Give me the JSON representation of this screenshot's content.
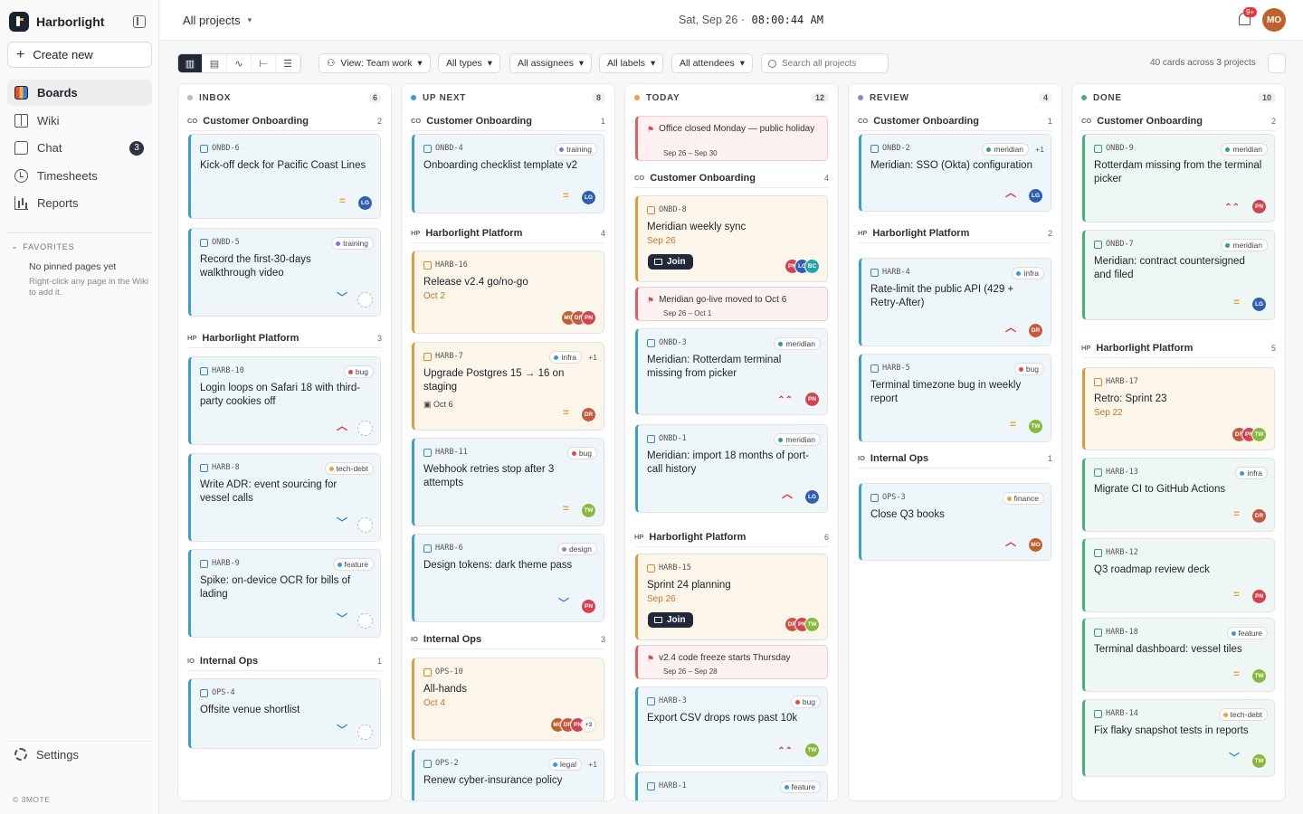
{
  "app": {
    "name": "Harborlight",
    "create_label": "Create new",
    "copyright": "© 3MOTE"
  },
  "nav": [
    {
      "label": "Boards",
      "icon": "boards-icon"
    },
    {
      "label": "Wiki",
      "icon": "book-icon"
    },
    {
      "label": "Chat",
      "icon": "chat-icon",
      "badge": "3"
    },
    {
      "label": "Timesheets",
      "icon": "clock-icon"
    },
    {
      "label": "Reports",
      "icon": "bar-chart-icon"
    }
  ],
  "favorites": {
    "heading": "FAVORITES",
    "empty": "No pinned pages yet",
    "hint": "Right-click any page in the Wiki to add it."
  },
  "settings_label": "Settings",
  "header": {
    "project": "All projects",
    "date": "Sat, Sep 26",
    "sep": "·",
    "time": "08:00:44 AM",
    "notif_badge": "9+",
    "user_initials": "MO"
  },
  "toolbar": {
    "view": "View: Team work",
    "types": "All types",
    "assignees": "All assignees",
    "labels": "All labels",
    "attendees": "All attendees",
    "search_placeholder": "Search all projects",
    "count": "40 cards across 3 projects"
  },
  "columns": [
    {
      "name": "INBOX",
      "count": "6",
      "color": "#bbbbbb",
      "groups": [
        {
          "key": "CO",
          "name": "Customer Onboarding",
          "count": "2",
          "cards": [
            {
              "id": "ONBD-6",
              "title": "Kick-off deck for Pacific Coast Lines",
              "prio": "=",
              "av": [
                "LG"
              ]
            },
            {
              "id": "ONBD-5",
              "tag": "training",
              "title": "Record the first-30-days walkthrough video",
              "prio": "⌄"
            }
          ]
        },
        {
          "key": "HP",
          "name": "Harborlight Platform",
          "count": "3",
          "cards": [
            {
              "id": "HARB-10",
              "tag": "bug",
              "title": "Login loops on Safari 18 with third-party cookies off",
              "prio": "^"
            },
            {
              "id": "HARB-8",
              "tag": "tech-debt",
              "title": "Write ADR: event sourcing for vessel calls",
              "prio": "⌄"
            },
            {
              "id": "HARB-9",
              "tag": "feature",
              "title": "Spike: on-device OCR for bills of lading",
              "prio": "⌄"
            }
          ]
        },
        {
          "key": "IO",
          "name": "Internal Ops",
          "count": "1",
          "cards": [
            {
              "id": "OPS-4",
              "title": "Offsite venue shortlist",
              "prio": "⌄"
            }
          ]
        }
      ]
    },
    {
      "name": "UP NEXT",
      "count": "8",
      "color": "#3a9ad9",
      "groups": [
        {
          "key": "CO",
          "name": "Customer Onboarding",
          "count": "1",
          "cards": [
            {
              "id": "ONBD-4",
              "tag": "training",
              "title": "Onboarding checklist template v2",
              "prio": "=",
              "av": [
                "LG"
              ]
            }
          ]
        },
        {
          "key": "HP",
          "name": "Harborlight Platform",
          "count": "4",
          "cards": [
            {
              "id": "HARB-16",
              "title": "Release v2.4 go/no-go",
              "date": "Oct 2",
              "av": [
                "MO",
                "DR",
                "PN"
              ]
            },
            {
              "id": "HARB-7",
              "tag": "infra",
              "extra": "+1",
              "title": "Upgrade Postgres 15 → 16 on staging",
              "date": "Oct 6",
              "prio": "=",
              "av": [
                "DR"
              ]
            },
            {
              "id": "HARB-11",
              "tag": "bug",
              "title": "Webhook retries stop after 3 attempts",
              "prio": "=",
              "av": [
                "TW"
              ]
            },
            {
              "id": "HARB-6",
              "tag": "design",
              "title": "Design tokens: dark theme pass",
              "prio": "⌄",
              "av": [
                "PN"
              ]
            }
          ]
        },
        {
          "key": "IO",
          "name": "Internal Ops",
          "count": "3",
          "cards": [
            {
              "id": "OPS-10",
              "title": "All-hands",
              "date": "Oct 4",
              "av": [
                "MO",
                "DR",
                "PN"
              ],
              "more": "+3"
            },
            {
              "id": "OPS-2",
              "tag": "legal",
              "extra": "+1",
              "title": "Renew cyber-insurance policy"
            }
          ]
        }
      ]
    },
    {
      "name": "TODAY",
      "count": "12",
      "color": "#e8a33b",
      "events": [
        {
          "title": "Office closed Monday — public holiday",
          "dates": "Sep 26 – Sep 30"
        },
        {
          "title": "Meridian go-live moved to Oct 6",
          "dates": "Sep 26 – Oct 1"
        },
        {
          "title": "v2.4 code freeze starts Thursday",
          "dates": "Sep 26 – Sep 28"
        }
      ],
      "groups": [
        {
          "key": "CO",
          "name": "Customer Onboarding",
          "count": "4",
          "cards": [
            {
              "id": "ONBD-8",
              "title": "Meridian weekly sync",
              "date": "Sep 26",
              "join": "Join",
              "av": [
                "PN",
                "LG",
                "BC"
              ]
            },
            {
              "id": "ONBD-3",
              "tag": "meridian",
              "title": "Meridian: Rotterdam terminal missing from picker",
              "prio": "⌃⌃",
              "av": [
                "PN"
              ]
            },
            {
              "id": "ONBD-1",
              "tag": "meridian",
              "title": "Meridian: import 18 months of port-call history",
              "prio": "^",
              "av": [
                "LG"
              ]
            }
          ]
        },
        {
          "key": "HP",
          "name": "Harborlight Platform",
          "count": "6",
          "cards": [
            {
              "id": "HARB-15",
              "title": "Sprint 24 planning",
              "date": "Sep 26",
              "join": "Join",
              "av": [
                "DR",
                "PN",
                "TW"
              ]
            },
            {
              "id": "HARB-3",
              "tag": "bug",
              "title": "Export CSV drops rows past 10k",
              "prio": "⌃⌃",
              "av": [
                "TW"
              ]
            },
            {
              "id": "HARB-1",
              "tag": "feature",
              "title": ""
            }
          ]
        }
      ]
    },
    {
      "name": "REVIEW",
      "count": "4",
      "color": "#9b7be0",
      "groups": [
        {
          "key": "CO",
          "name": "Customer Onboarding",
          "count": "1",
          "cards": [
            {
              "id": "ONBD-2",
              "tag": "meridian",
              "extra": "+1",
              "title": "Meridian: SSO (Okta) configuration",
              "prio": "^",
              "av": [
                "LG"
              ]
            }
          ]
        },
        {
          "key": "HP",
          "name": "Harborlight Platform",
          "count": "2",
          "cards": [
            {
              "id": "HARB-4",
              "tag": "infra",
              "title": "Rate-limit the public API (429 + Retry-After)",
              "prio": "^",
              "av": [
                "DR"
              ]
            },
            {
              "id": "HARB-5",
              "tag": "bug",
              "title": "Terminal timezone bug in weekly report",
              "prio": "=",
              "av": [
                "TW"
              ]
            }
          ]
        },
        {
          "key": "IO",
          "name": "Internal Ops",
          "count": "1",
          "cards": [
            {
              "id": "OPS-3",
              "tag": "finance",
              "title": "Close Q3 books",
              "prio": "^",
              "av": [
                "MO"
              ]
            }
          ]
        }
      ]
    },
    {
      "name": "DONE",
      "count": "10",
      "color": "#45b27a",
      "groups": [
        {
          "key": "CO",
          "name": "Customer Onboarding",
          "count": "2",
          "cards": [
            {
              "id": "ONBD-9",
              "tag": "meridian",
              "title": "Rotterdam missing from the terminal picker",
              "prio": "⌃⌃",
              "av": [
                "PN"
              ]
            },
            {
              "id": "ONBD-7",
              "tag": "meridian",
              "title": "Meridian: contract countersigned and filed",
              "prio": "=",
              "av": [
                "LG"
              ]
            }
          ]
        },
        {
          "key": "HP",
          "name": "Harborlight Platform",
          "count": "5",
          "cards": [
            {
              "id": "HARB-17",
              "title": "Retro: Sprint 23",
              "date": "Sep 22",
              "av": [
                "DR",
                "PN",
                "TW"
              ]
            },
            {
              "id": "HARB-13",
              "tag": "infra",
              "title": "Migrate CI to GitHub Actions",
              "prio": "=",
              "av": [
                "DR"
              ]
            },
            {
              "id": "HARB-12",
              "title": "Q3 roadmap review deck",
              "prio": "=",
              "av": [
                "PN"
              ]
            },
            {
              "id": "HARB-18",
              "tag": "feature",
              "title": "Terminal dashboard: vessel tiles",
              "prio": "=",
              "av": [
                "TW"
              ]
            },
            {
              "id": "HARB-14",
              "tag": "tech-debt",
              "title": "Fix flaky snapshot tests in reports",
              "prio": "⌄",
              "av": [
                "TW"
              ]
            }
          ]
        }
      ]
    }
  ],
  "colors": {
    "accent": "#1f2937",
    "LG": "#2f5fb3",
    "PN": "#d2434f",
    "DR": "#c9573b",
    "TW": "#86b93c",
    "MO": "#c0602a",
    "BC": "#2aa3a8"
  }
}
